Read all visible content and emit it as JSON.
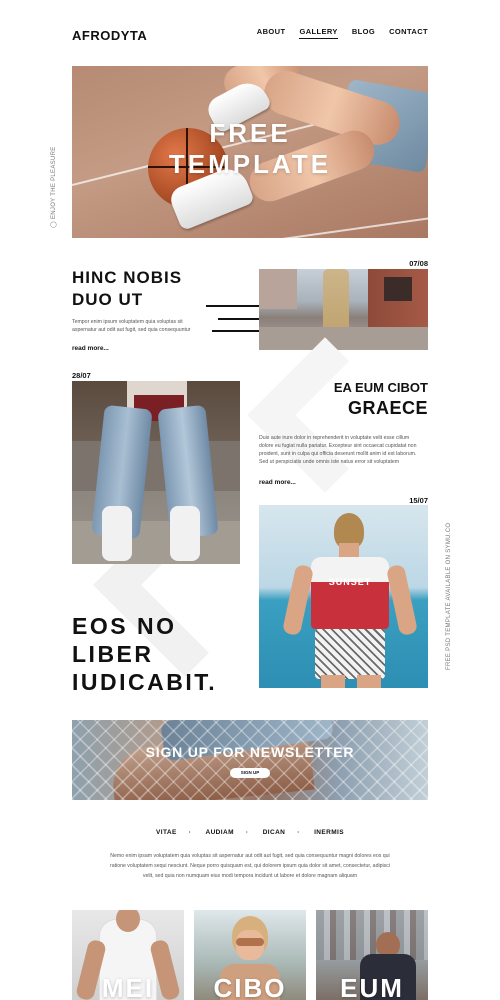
{
  "header": {
    "logo": "AFRODYTA",
    "nav": [
      {
        "label": "ABOUT"
      },
      {
        "label": "GALLERY",
        "active": true
      },
      {
        "label": "BLOG"
      },
      {
        "label": "CONTACT"
      }
    ]
  },
  "hero": {
    "title_line1": "FREE",
    "title_line2": "TEMPLATE"
  },
  "side_text_left": "ENJOY THE PLEASURE",
  "side_text_right": "FREE PSD TEMPLATE AVAILABLE ON SYMU.CO",
  "article1": {
    "title_line1": "HINC NOBIS",
    "title_line2": "DUO UT",
    "date": "07/08",
    "body": "Tempor enim ipsum voluptatem quia voluptas sit aspernatur aut odit aut fugit, sed quia consequuntur",
    "read_more": "read more..."
  },
  "article2": {
    "date": "28/07",
    "title_line1": "EA EUM CIBOT",
    "title_line2": "GRAECE",
    "body": "Duis aute irure dolor in reprehenderit in voluptate velit esse cillum dolore eu fugiat nulla pariatur. Excepteur sint occaecat cupidatat non proident, sunt in culpa qui officia deserunt mollit anim id est laborum. Sed ut perspiciatis unde omnis iste natus error sit voluptatem",
    "read_more": "read more..."
  },
  "article3": {
    "date": "15/07",
    "shirt_text": "SUNSET",
    "quote_line1": "EOS NO",
    "quote_line2": "LIBER",
    "quote_line3": "IUDICABIT."
  },
  "newsletter": {
    "title": "SIGN UP FOR NEWSLETTER",
    "button": "SIGN UP"
  },
  "tags": [
    "VITAE",
    "AUDIAM",
    "DICAN",
    "INERMIS"
  ],
  "paragraph": "Nemo enim ipsam voluptatem quia voluptas sit aspernatur aut odit aut fugit, sed quia consequuntur magni dolores eos qui ratione voluptatem sequi nesciunt. Neque porro quisquam est, qui dolorem ipsum quia dolor sit amet, consectetur, adipisci velit, sed quia non numquam eius modi tempora incidunt ut labore et dolore magnam aliquam",
  "cards": [
    {
      "label": "MEI"
    },
    {
      "label": "CIBO"
    },
    {
      "label": "EUM"
    }
  ]
}
